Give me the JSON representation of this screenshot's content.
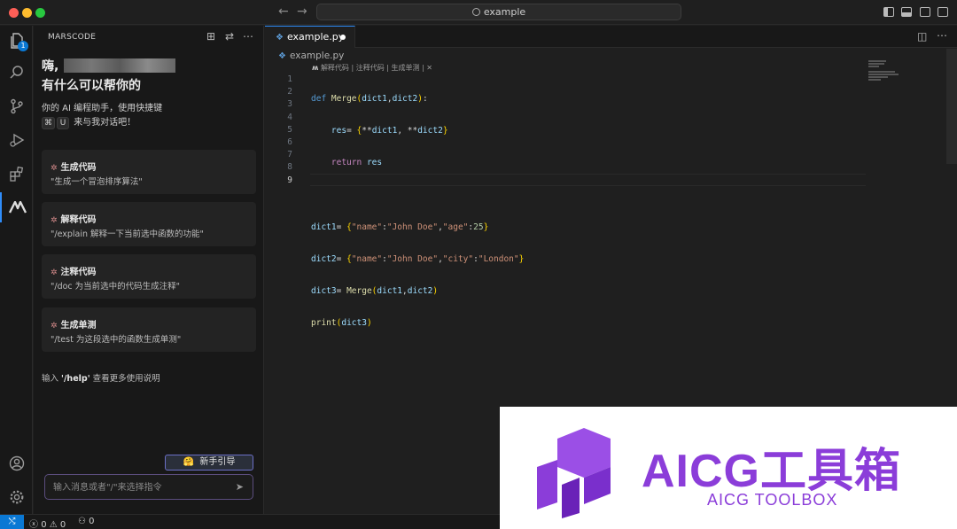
{
  "titlebar": {
    "search_text": "example"
  },
  "activity": {
    "explorer_badge": "1"
  },
  "sidebar": {
    "title": "MARSCODE",
    "greeting_prefix": "嗨,",
    "greeting_line2": "有什么可以帮你的",
    "intro_line1": "你的 AI 编程助手，使用快捷键",
    "shortcut_key1": "⌘",
    "shortcut_key2": "U",
    "intro_line2": "来与我对话吧！",
    "cards": [
      {
        "title": "生成代码",
        "subtitle": "\"生成一个冒泡排序算法\""
      },
      {
        "title": "解释代码",
        "subtitle": "\"/explain 解释一下当前选中函数的功能\""
      },
      {
        "title": "注释代码",
        "subtitle": "\"/doc 为当前选中的代码生成注释\""
      },
      {
        "title": "生成单测",
        "subtitle": "\"/test 为这段选中的函数生成单测\""
      }
    ],
    "help_prefix": "输入",
    "help_command": "'/help'",
    "help_suffix": "查看更多使用说明",
    "guide_button": "新手引导",
    "guide_emoji": "🤗",
    "input_placeholder": "输入消息或者\"/\"来选择指令"
  },
  "editor": {
    "tab_label": "example.py",
    "breadcrumb": "example.py",
    "codelens": "解释代码 | 注释代码 | 生成单测 | ✕",
    "line_numbers": [
      "1",
      "2",
      "3",
      "4",
      "5",
      "6",
      "7",
      "8",
      "9"
    ]
  },
  "statusbar": {
    "errors": "0",
    "warnings": "0",
    "ports": "0"
  },
  "watermark": {
    "title": "AICG工具箱",
    "subtitle": "AICG TOOLBOX",
    "brand_color": "#8b3dd9"
  }
}
